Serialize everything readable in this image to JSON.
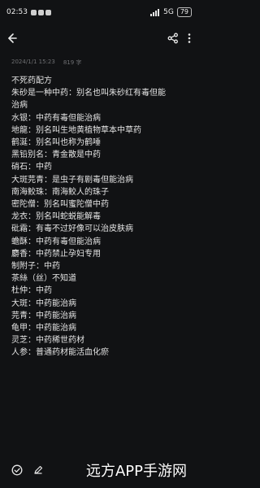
{
  "status": {
    "time": "02:53",
    "right_text": "5G",
    "battery": "79"
  },
  "toolbar": {
    "back_icon": "back-arrow-icon",
    "share_icon": "share-icon",
    "more_icon": "more-vertical-icon"
  },
  "meta": {
    "date": "2024/1/1 15:23",
    "count": "819 字"
  },
  "note": {
    "lines": [
      "不死药配方",
      "朱砂是一种中药：别名也叫朱砂红有毒但能",
      "治病",
      "水银：中药有毒但能治病",
      "地龍：别名叫生地黄植物草本中草药",
      "鹤涎：别名叫也称为鹤唾",
      "黑铅别名：青金散是中药",
      "硝石：中药",
      "大斑芫青：是虫子有剧毒但能治病",
      "南海鲛珠：南海鲛人的珠子",
      "密陀僧：别名叫蜜陀僧中药",
      "龙衣：别名叫蛇蜕能解毒",
      "砒霜：有毒不过好像可以治皮肤病",
      "蟾酥：中药有毒但能治病",
      "麝香：中药禁止孕妇专用",
      "制附子：中药",
      "茶絲（丝）不知道",
      "杜仲：中药",
      "大斑：中药能治病",
      "芫青：中药能治病",
      "龟甲：中药能治病",
      "灵芝：中药稀世药材",
      "人参：普通药材能活血化瘀"
    ]
  },
  "bottom": {
    "check_icon": "check-circle-icon",
    "pen_icon": "pen-icon",
    "watermark": "远方APP手游网"
  }
}
